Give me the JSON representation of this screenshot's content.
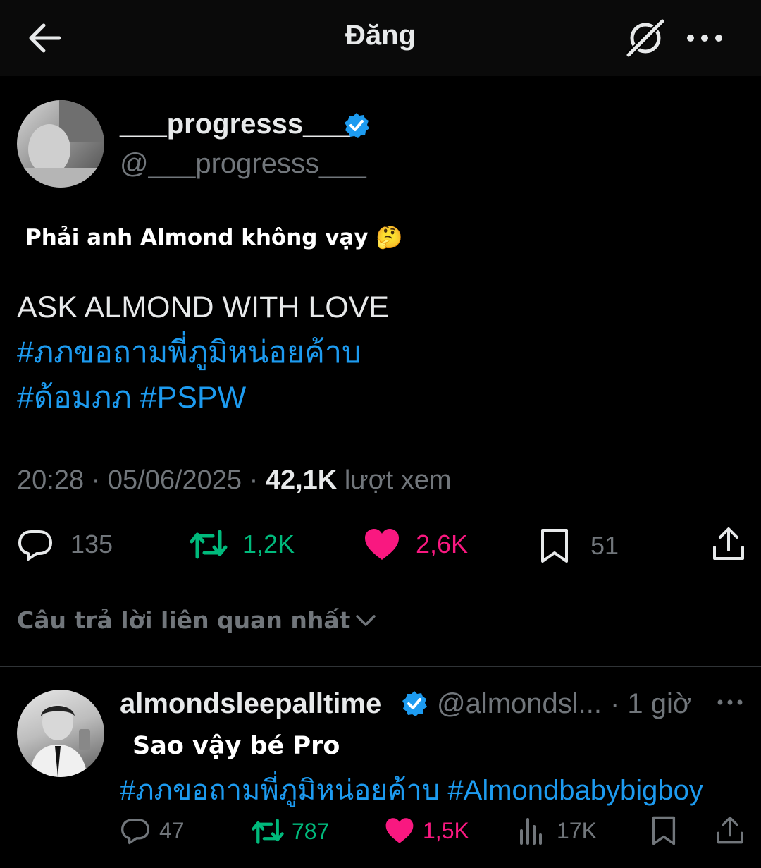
{
  "header": {
    "title": "Đăng"
  },
  "post": {
    "display_name": "___progresss___",
    "handle": "@___progresss___",
    "overlay_text": "Phải anh Almond không vạy 🤔",
    "body_line1": "ASK ALMOND WITH LOVE",
    "hashtag1": "#ภภขอถามพี่ภูมิหน่อยค้าบ",
    "hashtag2": "#ด้อมภภ",
    "hashtag3": "#PSPW",
    "time": "20:28",
    "date": "05/06/2025",
    "views_count": "42,1K",
    "views_label": "lượt xem",
    "replies": "135",
    "reposts": "1,2K",
    "likes": "2,6K",
    "bookmarks": "51"
  },
  "replies_sort": {
    "label": "Câu trả lời liên quan nhất"
  },
  "reply": {
    "display_name": "almondsleepalltime",
    "handle": "@almondsl...",
    "time": "· 1 giờ",
    "overlay_text": "Sao vậy bé Pro",
    "hashtag1": "#ภภขอถามพี่ภูมิหน่อยค้าบ",
    "hashtag2": "#Almondbabybigboy",
    "replies": "47",
    "reposts": "787",
    "likes": "1,5K",
    "views": "17K"
  },
  "colors": {
    "background": "#000000",
    "text": "#e7e9ea",
    "secondary": "#71767b",
    "link": "#1d9bf0",
    "verified": "#1d9bf0",
    "repost_active": "#00ba7c",
    "like_active": "#f91880"
  }
}
